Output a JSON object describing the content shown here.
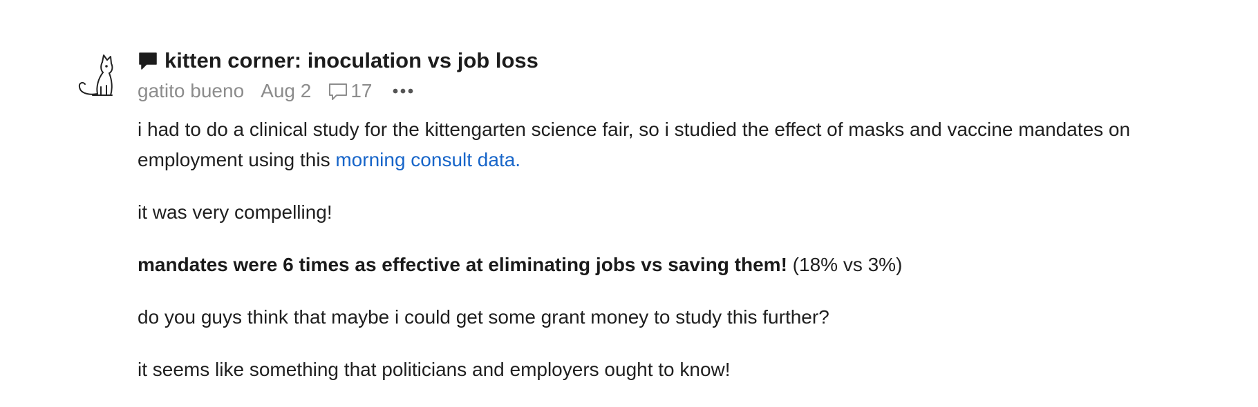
{
  "post": {
    "title": "kitten corner: inoculation vs job loss",
    "author": "gatito bueno",
    "date": "Aug 2",
    "comment_count": "17",
    "icons": {
      "avatar": "cat-avatar-icon",
      "title": "chat-bubble-icon",
      "comments": "comment-icon",
      "more": "more-options-icon"
    },
    "colors": {
      "link": "#1765c9",
      "meta": "#8c8c8c",
      "text": "#1f1f1f"
    },
    "body": {
      "p1_text": "i had to do a clinical study for the kittengarten science fair, so i studied the effect of masks and vaccine mandates on employment using this ",
      "p1_link": "morning consult data.",
      "p2": "it was very compelling!",
      "p3_bold": "mandates were 6 times as effective at eliminating jobs vs saving them!",
      "p3_rest": " (18% vs 3%)",
      "p4": "do you guys think that maybe i could get some grant money to study this further?",
      "p5": "it seems like something that politicians and employers ought to know!"
    }
  }
}
